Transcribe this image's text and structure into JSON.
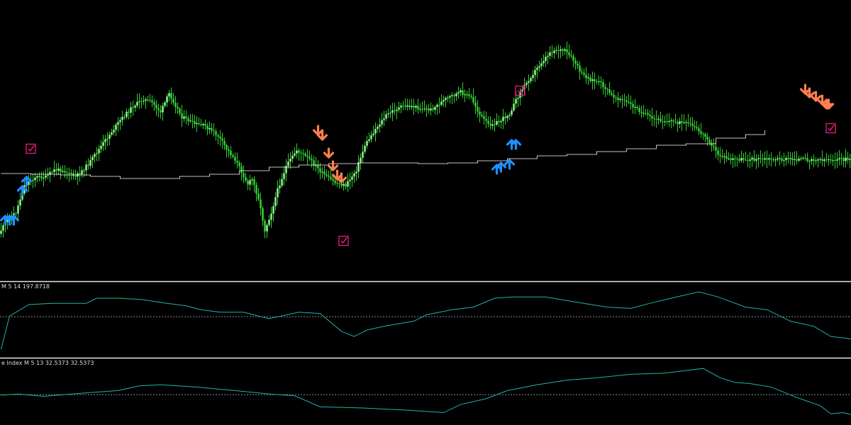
{
  "colors": {
    "background": "#000000",
    "candle_up": "#90ee90",
    "candle_down": "#32cd32",
    "wick": "#32cd32",
    "trend_line": "#ffffff",
    "indicator_line": "#20b2aa",
    "level_line": "#bdbdbd",
    "separator": "#e6e6e6",
    "buy_arrow": "#1e90ff",
    "sell_arrow": "#ff7f50",
    "check_box": "#d81b7a"
  },
  "panels": {
    "indicator1_label": "M 5 14 197.8718",
    "indicator2_label": "e Index M 5 13 32.5373 32.5373"
  },
  "icons": {
    "buy": "arrow-up-icon",
    "sell": "arrow-down-icon",
    "signal": "checkbox-icon"
  },
  "chart_data": [
    {
      "type": "candlestick",
      "title": "",
      "grid": false,
      "axes_visible": false,
      "anchors": [
        [
          0,
          330
        ],
        [
          4,
          310
        ],
        [
          8,
          300
        ],
        [
          12,
          262
        ],
        [
          17,
          250
        ],
        [
          22,
          250
        ],
        [
          26,
          240
        ],
        [
          30,
          240
        ],
        [
          36,
          250
        ],
        [
          42,
          232
        ],
        [
          50,
          198
        ],
        [
          57,
          170
        ],
        [
          63,
          150
        ],
        [
          68,
          140
        ],
        [
          72,
          145
        ],
        [
          76,
          158
        ],
        [
          80,
          132
        ],
        [
          86,
          165
        ],
        [
          92,
          175
        ],
        [
          97,
          178
        ],
        [
          103,
          192
        ],
        [
          107,
          210
        ],
        [
          111,
          225
        ],
        [
          115,
          248
        ],
        [
          117,
          260
        ],
        [
          119,
          253
        ],
        [
          122,
          280
        ],
        [
          125,
          325
        ],
        [
          128,
          300
        ],
        [
          131,
          268
        ],
        [
          135,
          235
        ],
        [
          140,
          212
        ],
        [
          146,
          225
        ],
        [
          152,
          245
        ],
        [
          158,
          258
        ],
        [
          163,
          262
        ],
        [
          168,
          240
        ],
        [
          172,
          205
        ],
        [
          177,
          182
        ],
        [
          182,
          163
        ],
        [
          186,
          155
        ],
        [
          190,
          150
        ],
        [
          194,
          150
        ],
        [
          198,
          153
        ],
        [
          203,
          155
        ],
        [
          210,
          140
        ],
        [
          217,
          130
        ],
        [
          222,
          138
        ],
        [
          226,
          162
        ],
        [
          230,
          176
        ],
        [
          235,
          172
        ],
        [
          240,
          160
        ],
        [
          245,
          130
        ],
        [
          250,
          108
        ],
        [
          255,
          88
        ],
        [
          259,
          74
        ],
        [
          262,
          70
        ],
        [
          266,
          72
        ],
        [
          270,
          85
        ],
        [
          274,
          105
        ],
        [
          278,
          112
        ],
        [
          283,
          118
        ],
        [
          288,
          135
        ],
        [
          292,
          140
        ],
        [
          296,
          146
        ],
        [
          300,
          154
        ],
        [
          303,
          160
        ],
        [
          307,
          168
        ],
        [
          312,
          170
        ],
        [
          318,
          172
        ],
        [
          325,
          176
        ],
        [
          333,
          195
        ],
        [
          338,
          218
        ],
        [
          343,
          225
        ],
        [
          348,
          225
        ]
      ],
      "trend_line": [
        [
          0,
          245
        ],
        [
          14,
          246
        ],
        [
          28,
          247
        ],
        [
          42,
          249
        ],
        [
          56,
          252
        ],
        [
          70,
          252
        ],
        [
          84,
          249
        ],
        [
          98,
          246
        ],
        [
          112,
          241
        ],
        [
          126,
          236
        ],
        [
          140,
          233
        ],
        [
          154,
          231
        ],
        [
          168,
          230
        ],
        [
          182,
          230
        ],
        [
          196,
          231
        ],
        [
          210,
          230
        ],
        [
          224,
          227
        ],
        [
          238,
          224
        ],
        [
          252,
          220
        ],
        [
          266,
          218
        ],
        [
          280,
          214
        ],
        [
          294,
          210
        ],
        [
          308,
          205
        ],
        [
          322,
          203
        ],
        [
          336,
          195
        ],
        [
          350,
          190
        ],
        [
          359,
          184
        ]
      ],
      "signals_buy": [
        [
          2,
          312
        ],
        [
          4,
          312
        ],
        [
          6,
          312
        ],
        [
          10,
          270
        ],
        [
          12,
          257
        ],
        [
          233,
          240
        ],
        [
          235,
          237
        ],
        [
          239,
          233
        ],
        [
          240,
          205
        ],
        [
          242,
          205
        ]
      ],
      "signals_sell": [
        [
          149,
          183
        ],
        [
          151,
          190
        ],
        [
          154,
          215
        ],
        [
          156,
          233
        ],
        [
          158,
          246
        ],
        [
          160,
          250
        ],
        [
          378,
          125
        ],
        [
          380,
          130
        ],
        [
          383,
          135
        ],
        [
          386,
          140
        ],
        [
          388,
          146
        ],
        [
          389,
          146
        ]
      ],
      "signals_check": [
        [
          14,
          210
        ],
        [
          161,
          340
        ],
        [
          244,
          128
        ],
        [
          390,
          181
        ]
      ]
    },
    {
      "type": "line",
      "label": "M 5 14 197.8718",
      "ylim": [
        0,
        100
      ],
      "level": 51,
      "series": [
        {
          "values": [
            [
              0,
              0
            ],
            [
              4,
              52
            ],
            [
              13,
              70
            ],
            [
              24,
              72
            ],
            [
              40,
              72
            ],
            [
              45,
              80
            ],
            [
              55,
              80
            ],
            [
              66,
              78
            ],
            [
              78,
              72
            ],
            [
              87,
              68
            ],
            [
              94,
              62
            ],
            [
              103,
              58
            ],
            [
              114,
              58
            ],
            [
              126,
              48
            ],
            [
              140,
              58
            ],
            [
              150,
              56
            ],
            [
              160,
              28
            ],
            [
              166,
              20
            ],
            [
              172,
              30
            ],
            [
              180,
              36
            ],
            [
              194,
              44
            ],
            [
              200,
              54
            ],
            [
              212,
              62
            ],
            [
              222,
              66
            ],
            [
              232,
              80
            ],
            [
              240,
              82
            ],
            [
              256,
              82
            ],
            [
              270,
              74
            ],
            [
              285,
              66
            ],
            [
              296,
              64
            ],
            [
              305,
              72
            ],
            [
              315,
              80
            ],
            [
              328,
              90
            ],
            [
              337,
              82
            ],
            [
              350,
              66
            ],
            [
              360,
              62
            ],
            [
              371,
              44
            ],
            [
              382,
              36
            ],
            [
              390,
              20
            ],
            [
              400,
              16
            ]
          ]
        }
      ]
    },
    {
      "type": "line",
      "label": "e Index M 5 13 32.5373 32.5373",
      "ylim": [
        0,
        100
      ],
      "level": 45,
      "series": [
        {
          "values": [
            [
              0,
              44
            ],
            [
              8,
              46
            ],
            [
              20,
              42
            ],
            [
              40,
              48
            ],
            [
              55,
              52
            ],
            [
              65,
              60
            ],
            [
              75,
              62
            ],
            [
              92,
              58
            ],
            [
              110,
              52
            ],
            [
              126,
              46
            ],
            [
              138,
              43
            ],
            [
              150,
              24
            ],
            [
              170,
              22
            ],
            [
              192,
              18
            ],
            [
              208,
              14
            ],
            [
              216,
              28
            ],
            [
              228,
              38
            ],
            [
              238,
              52
            ],
            [
              252,
              62
            ],
            [
              266,
              70
            ],
            [
              280,
              74
            ],
            [
              296,
              80
            ],
            [
              312,
              82
            ],
            [
              330,
              90
            ],
            [
              338,
              74
            ],
            [
              345,
              66
            ],
            [
              352,
              64
            ],
            [
              362,
              58
            ],
            [
              374,
              40
            ],
            [
              385,
              26
            ],
            [
              390,
              12
            ],
            [
              396,
              14
            ],
            [
              400,
              10
            ]
          ]
        }
      ]
    }
  ]
}
